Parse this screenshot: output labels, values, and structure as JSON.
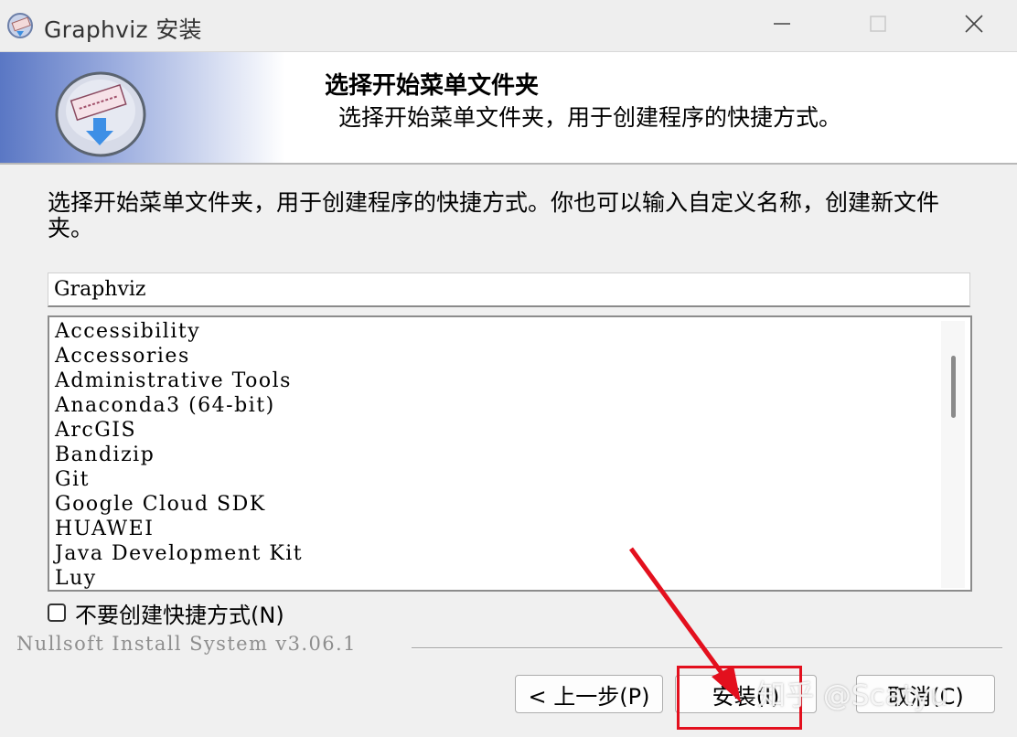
{
  "window": {
    "title": "Graphviz 安装",
    "minimize_icon": "minimize-icon",
    "maximize_icon": "maximize-icon",
    "close_icon": "close-icon"
  },
  "header": {
    "title": "选择开始菜单文件夹",
    "subtitle": "选择开始菜单文件夹，用于创建程序的快捷方式。"
  },
  "description": "选择开始菜单文件夹，用于创建程序的快捷方式。你也可以输入自定义名称，创建新文件夹。",
  "folder_input": {
    "value": "Graphviz"
  },
  "folder_list": {
    "items": [
      "Accessibility",
      "Accessories",
      "Administrative Tools",
      "Anaconda3 (64-bit)",
      "ArcGIS",
      "Bandizip",
      "Git",
      "Google Cloud SDK",
      "HUAWEI",
      "Java Development Kit",
      "Luy"
    ]
  },
  "no_shortcuts_checkbox": {
    "label": "不要创建快捷方式(N)",
    "checked": false
  },
  "branding": "Nullsoft Install System v3.06.1",
  "buttons": {
    "back": "< 上一步(P)",
    "install": "安装(I)",
    "cancel": "取消(C)"
  },
  "annotation": {
    "color": "#e3101e"
  },
  "watermark": "知乎 @Scatyu"
}
